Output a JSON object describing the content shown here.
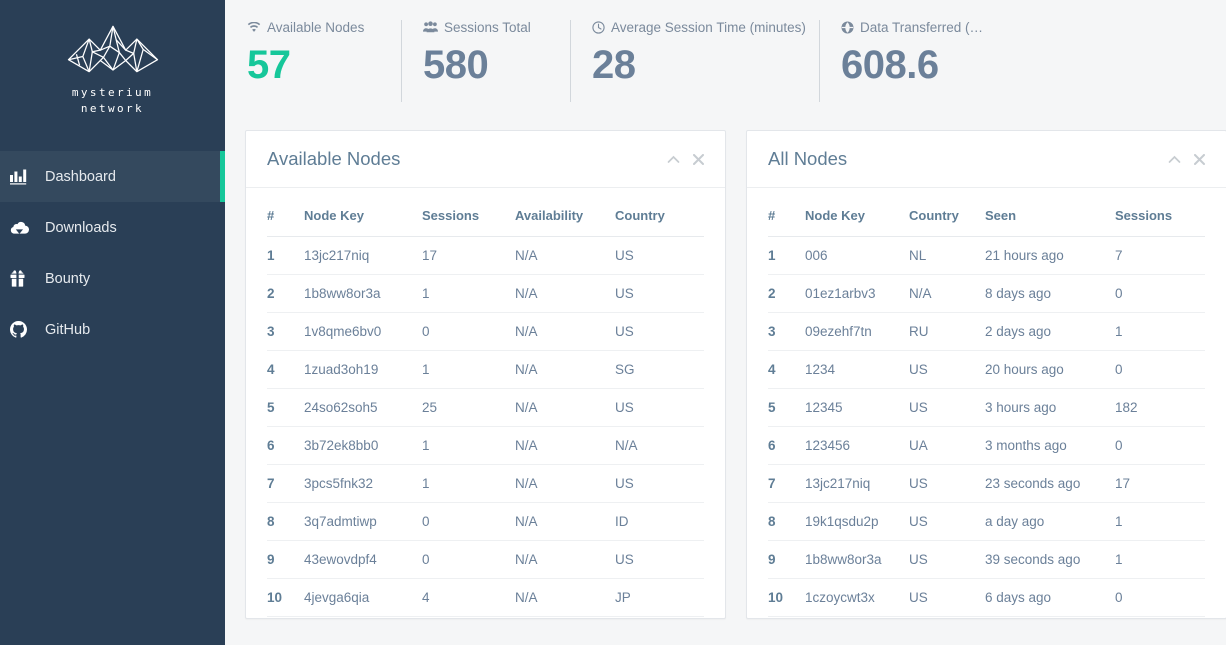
{
  "sidebar": {
    "brand": {
      "line1": "mysterium",
      "line2": "network",
      "logo_icon": "mountain-logo-icon"
    },
    "items": [
      {
        "label": "Dashboard",
        "icon": "bar-chart-icon",
        "active": true
      },
      {
        "label": "Downloads",
        "icon": "cloud-download-icon",
        "active": false
      },
      {
        "label": "Bounty",
        "icon": "gift-icon",
        "active": false
      },
      {
        "label": "GitHub",
        "icon": "github-icon",
        "active": false
      }
    ],
    "background_color": "#2a3f56",
    "active_accent_color": "#16c79a"
  },
  "stats": [
    {
      "label": "Available Nodes",
      "value": "57",
      "icon": "wifi-icon",
      "accent": true
    },
    {
      "label": "Sessions Total",
      "value": "580",
      "icon": "users-icon",
      "accent": false
    },
    {
      "label": "Average Session Time (minutes)",
      "value": "28",
      "icon": "clock-icon",
      "accent": false
    },
    {
      "label": "Data Transferred (…",
      "value": "608.6",
      "icon": "globe-icon",
      "accent": false
    }
  ],
  "panels": {
    "available_nodes": {
      "title": "Available Nodes",
      "collapse_icon": "chevron-up-icon",
      "close_icon": "close-icon",
      "columns": [
        "#",
        "Node Key",
        "Sessions",
        "Availability",
        "Country"
      ],
      "rows": [
        [
          "1",
          "13jc217niq",
          "17",
          "N/A",
          "US"
        ],
        [
          "2",
          "1b8ww8or3a",
          "1",
          "N/A",
          "US"
        ],
        [
          "3",
          "1v8qme6bv0",
          "0",
          "N/A",
          "US"
        ],
        [
          "4",
          "1zuad3oh19",
          "1",
          "N/A",
          "SG"
        ],
        [
          "5",
          "24so62soh5",
          "25",
          "N/A",
          "US"
        ],
        [
          "6",
          "3b72ek8bb0",
          "1",
          "N/A",
          "N/A"
        ],
        [
          "7",
          "3pcs5fnk32",
          "1",
          "N/A",
          "US"
        ],
        [
          "8",
          "3q7admtiwp",
          "0",
          "N/A",
          "ID"
        ],
        [
          "9",
          "43ewovdpf4",
          "0",
          "N/A",
          "US"
        ],
        [
          "10",
          "4jevga6qia",
          "4",
          "N/A",
          "JP"
        ]
      ]
    },
    "all_nodes": {
      "title": "All Nodes",
      "collapse_icon": "chevron-up-icon",
      "close_icon": "close-icon",
      "columns": [
        "#",
        "Node Key",
        "Country",
        "Seen",
        "Sessions"
      ],
      "rows": [
        [
          "1",
          "006",
          "NL",
          "21 hours ago",
          "7"
        ],
        [
          "2",
          "01ez1arbv3",
          "N/A",
          "8 days ago",
          "0"
        ],
        [
          "3",
          "09ezehf7tn",
          "RU",
          "2 days ago",
          "1"
        ],
        [
          "4",
          "1234",
          "US",
          "20 hours ago",
          "0"
        ],
        [
          "5",
          "12345",
          "US",
          "3 hours ago",
          "182"
        ],
        [
          "6",
          "123456",
          "UA",
          "3 months ago",
          "0"
        ],
        [
          "7",
          "13jc217niq",
          "US",
          "23 seconds ago",
          "17"
        ],
        [
          "8",
          "19k1qsdu2p",
          "US",
          "a day ago",
          "1"
        ],
        [
          "9",
          "1b8ww8or3a",
          "US",
          "39 seconds ago",
          "1"
        ],
        [
          "10",
          "1czoycwt3x",
          "US",
          "6 days ago",
          "0"
        ]
      ]
    }
  },
  "colors": {
    "page_background": "#f5f6f7",
    "panel_background": "#ffffff",
    "text_muted": "#6b8099",
    "accent_teal": "#16c79a"
  }
}
